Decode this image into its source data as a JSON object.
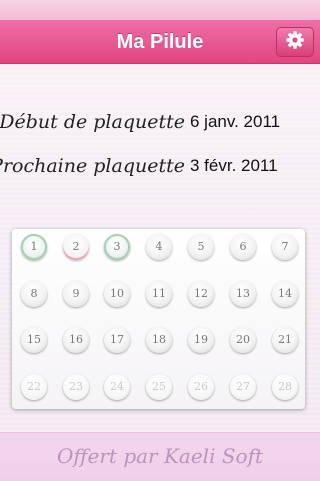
{
  "nav": {
    "title": "Ma Pilule",
    "settings_icon": "gear-icon"
  },
  "info": {
    "start_label": "Début de plaquette",
    "start_value": "6 janv. 2011",
    "next_label": "Prochaine plaquette",
    "next_value": "3 févr. 2011"
  },
  "pills": {
    "rows": [
      [
        {
          "label": "1",
          "state": "taken"
        },
        {
          "label": "2",
          "state": "current"
        },
        {
          "label": "3",
          "state": "taken"
        },
        {
          "label": "4",
          "state": "normal"
        },
        {
          "label": "5",
          "state": "normal"
        },
        {
          "label": "6",
          "state": "normal"
        },
        {
          "label": "7",
          "state": "normal"
        }
      ],
      [
        {
          "label": "8",
          "state": "normal"
        },
        {
          "label": "9",
          "state": "normal"
        },
        {
          "label": "10",
          "state": "normal"
        },
        {
          "label": "11",
          "state": "normal"
        },
        {
          "label": "12",
          "state": "normal"
        },
        {
          "label": "13",
          "state": "normal"
        },
        {
          "label": "14",
          "state": "normal"
        }
      ],
      [
        {
          "label": "15",
          "state": "normal"
        },
        {
          "label": "16",
          "state": "normal"
        },
        {
          "label": "17",
          "state": "normal"
        },
        {
          "label": "18",
          "state": "normal"
        },
        {
          "label": "19",
          "state": "normal"
        },
        {
          "label": "20",
          "state": "normal"
        },
        {
          "label": "21",
          "state": "normal"
        }
      ],
      [
        {
          "label": "22",
          "state": "placebo"
        },
        {
          "label": "23",
          "state": "placebo"
        },
        {
          "label": "24",
          "state": "placebo"
        },
        {
          "label": "25",
          "state": "placebo"
        },
        {
          "label": "26",
          "state": "placebo"
        },
        {
          "label": "27",
          "state": "placebo"
        },
        {
          "label": "28",
          "state": "placebo"
        }
      ]
    ]
  },
  "footer": {
    "text": "Offert par Kaeli Soft"
  },
  "colors": {
    "nav_pink": "#e2467f",
    "taken_ring": "#a9cdb9",
    "current_mark": "#f0a0b0"
  }
}
